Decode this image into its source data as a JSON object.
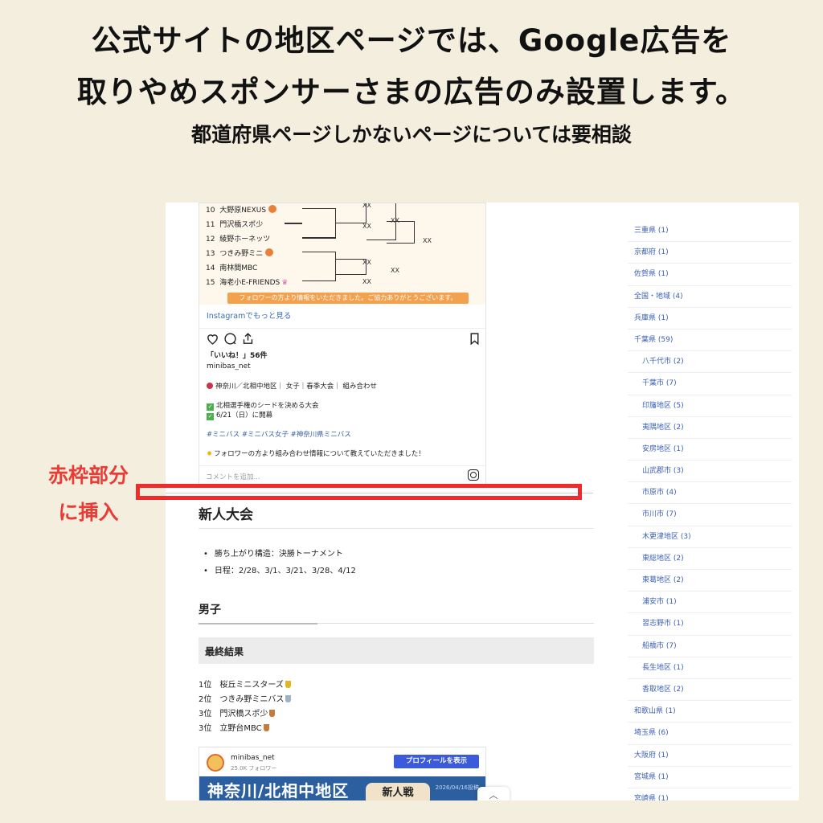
{
  "header": {
    "line1": "公式サイトの地区ページでは、Google広告を",
    "line2": "取りやめスポンサーさまの広告のみ設置します。",
    "line3": "都道府県ページしかないページについては要相談"
  },
  "note": {
    "line1": "赤枠部分",
    "line2": "に挿入"
  },
  "instagram": {
    "teams": [
      {
        "num": "10",
        "name": "大野原NEXUS"
      },
      {
        "num": "11",
        "name": "門沢橋スポ少"
      },
      {
        "num": "12",
        "name": "綾野ホーネッツ"
      },
      {
        "num": "13",
        "name": "つきみ野ミニ"
      },
      {
        "num": "14",
        "name": "南林間MBC"
      },
      {
        "num": "15",
        "name": "海老小E-FRIENDS"
      }
    ],
    "xx": "XX",
    "banner": "フォロワーの方より情報をいただきました。ご協力ありがとうございます。",
    "more_link": "Instagramでもっと見る",
    "likes": "「いいね！」56件",
    "user": "minibas_net",
    "caption_1": "神奈川／北相中地区｜ 女子｜春季大会｜ 組み合わせ",
    "caption_2": "北相選手権のシードを決める大会",
    "caption_3": "6/21（日）に開幕",
    "caption_tags": "#ミニバス #ミニバス女子 #神奈川県ミニバス",
    "caption_4": "フォロワーの方より組み合わせ情報について教えていただきました！",
    "comment_placeholder": "コメントを追加...",
    "icons": [
      "heart-icon",
      "comment-icon",
      "share-icon",
      "bookmark-icon",
      "instagram-icon"
    ]
  },
  "article": {
    "heading": "新人大会",
    "bullets": [
      "勝ち上がり構造：決勝トーナメント",
      "日程：2/28、3/1、3/21、3/28、4/12"
    ],
    "boys_heading": "男子",
    "final_heading": "最終結果",
    "ranks": [
      {
        "text": "1位　桜丘ミニスターズ",
        "medal": "#e6b422"
      },
      {
        "text": "2位　つきみ野ミニバス",
        "medal": "#9fb3c8"
      },
      {
        "text": "3位　門沢橋スポ少",
        "medal": "#c57b3c"
      },
      {
        "text": "3位　立野台MBC",
        "medal": "#c57b3c"
      }
    ]
  },
  "profile": {
    "name": "minibas_net",
    "followers": "25.0K フォロワー",
    "button": "プロフィールを表示",
    "banner_title": "神奈川/北相中地区",
    "date": "2026/04/16投稿",
    "badge": "新人戦"
  },
  "sidebar": {
    "items": [
      {
        "label": "三重県 (1)",
        "sub": false
      },
      {
        "label": "京都府 (1)",
        "sub": false
      },
      {
        "label": "佐賀県 (1)",
        "sub": false
      },
      {
        "label": "全国・地域 (4)",
        "sub": false
      },
      {
        "label": "兵庫県 (1)",
        "sub": false
      },
      {
        "label": "千葉県 (59)",
        "sub": false
      },
      {
        "label": "八千代市 (2)",
        "sub": true
      },
      {
        "label": "千葉市 (7)",
        "sub": true
      },
      {
        "label": "印旛地区 (5)",
        "sub": true
      },
      {
        "label": "夷隅地区 (2)",
        "sub": true
      },
      {
        "label": "安房地区 (1)",
        "sub": true
      },
      {
        "label": "山武郡市 (3)",
        "sub": true
      },
      {
        "label": "市原市 (4)",
        "sub": true
      },
      {
        "label": "市川市 (7)",
        "sub": true
      },
      {
        "label": "木更津地区 (3)",
        "sub": true
      },
      {
        "label": "東総地区 (2)",
        "sub": true
      },
      {
        "label": "東葛地区 (2)",
        "sub": true
      },
      {
        "label": "浦安市 (1)",
        "sub": true
      },
      {
        "label": "習志野市 (1)",
        "sub": true
      },
      {
        "label": "船橋市 (7)",
        "sub": true
      },
      {
        "label": "長生地区 (1)",
        "sub": true
      },
      {
        "label": "香取地区 (2)",
        "sub": true
      },
      {
        "label": "和歌山県 (1)",
        "sub": false
      },
      {
        "label": "埼玉県 (6)",
        "sub": false
      },
      {
        "label": "大阪府 (1)",
        "sub": false
      },
      {
        "label": "宮城県 (1)",
        "sub": false
      },
      {
        "label": "宮崎県 (1)",
        "sub": false
      }
    ]
  },
  "colors": {
    "highlight": "#ef2b2b",
    "background": "#f4eedf",
    "link": "#3b5fb5",
    "button": "#3b5bdb"
  }
}
